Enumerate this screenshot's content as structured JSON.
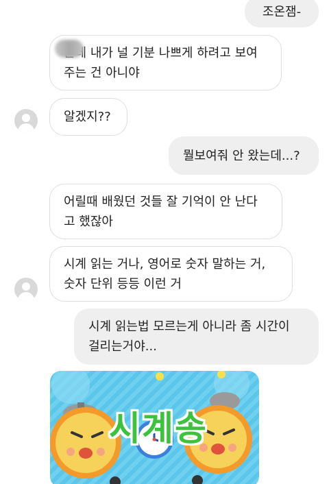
{
  "messages": [
    {
      "id": "m1",
      "side": "out",
      "text": "조온잼-"
    },
    {
      "id": "m2",
      "side": "in",
      "text": "근데 내가 널 기분 나쁘게 하려고 보여\n주는 건 아니야"
    },
    {
      "id": "m3",
      "side": "in",
      "text": "알겠지??"
    },
    {
      "id": "m4",
      "side": "out",
      "text": "뭘보여줘 안 왔는데...?"
    },
    {
      "id": "m5",
      "side": "in",
      "text": "어릴때 배웠던 것들 잘 기억이 안 난다\n고 했잖아"
    },
    {
      "id": "m6",
      "side": "in",
      "text": "시계 읽는 거나, 영어로 숫자 말하는 거,\n숫자 단위 등등 이런 거"
    },
    {
      "id": "m7",
      "side": "out",
      "text": "시계 읽는법 모르는게 아니라 좀 시간이\n걸리는거야..."
    }
  ],
  "sticker": {
    "title": "시계송",
    "accent_colors": {
      "background": "#6fd0f0",
      "title_fill": "#3cc23c",
      "title_stroke": "#ffffff",
      "clock_face": "#f7d25a",
      "clock_body": "#f39a2b"
    }
  },
  "colors": {
    "bubble_out": "#efefef",
    "bubble_in_border": "#dedede",
    "avatar": "#d9d9d9",
    "text": "#222222"
  },
  "icons": [
    "default-avatar-icon",
    "alarm-clock-icon"
  ]
}
